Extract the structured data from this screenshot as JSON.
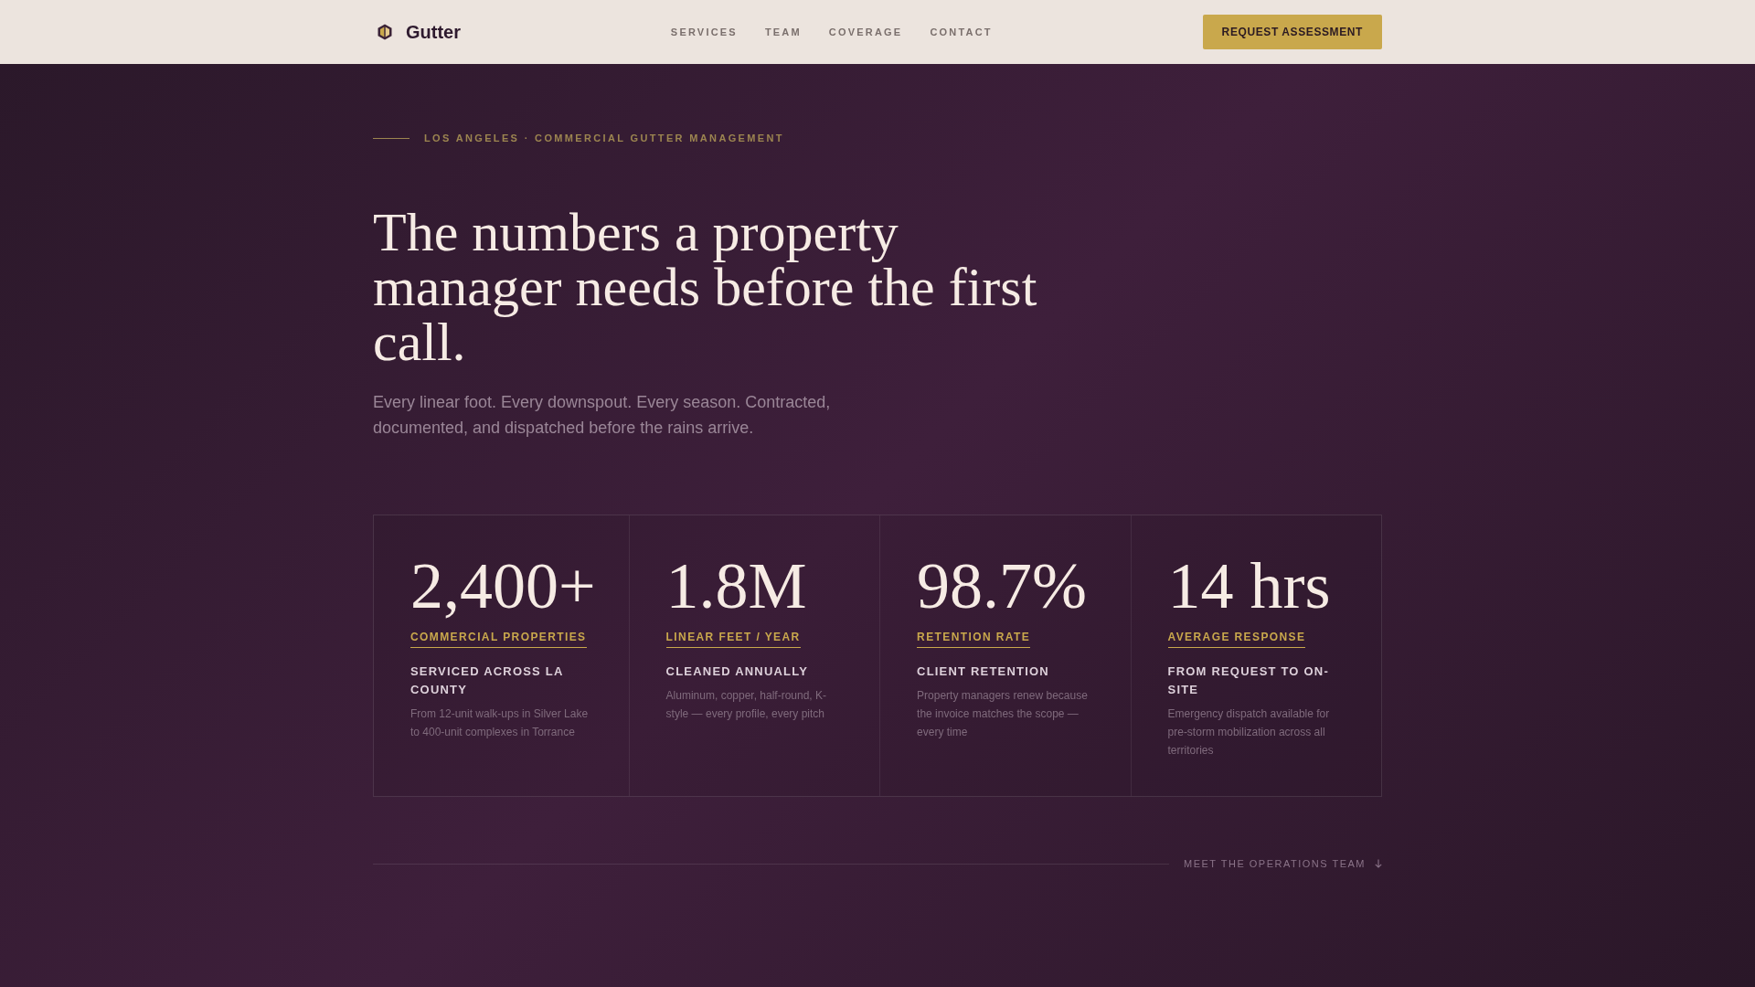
{
  "nav": {
    "brand": "Gutter",
    "links": [
      "SERVICES",
      "TEAM",
      "COVERAGE",
      "CONTACT"
    ],
    "cta": "REQUEST ASSESSMENT"
  },
  "hero": {
    "eyebrow": "LOS ANGELES · COMMERCIAL GUTTER MANAGEMENT",
    "heading": "The numbers a property manager needs before the first call.",
    "subtitle": "Every linear foot. Every downspout. Every season. Contracted, documented, and dispatched before the rains arrive."
  },
  "stats": [
    {
      "value": "2,400+",
      "label": "COMMERCIAL PROPERTIES",
      "title": "SERVICED ACROSS LA COUNTY",
      "description": "From 12-unit walk-ups in Silver Lake to 400-unit complexes in Torrance"
    },
    {
      "value": "1.8M",
      "label": "LINEAR FEET / YEAR",
      "title": "CLEANED ANNUALLY",
      "description": "Aluminum, copper, half-round, K-style — every profile, every pitch"
    },
    {
      "value": "98.7%",
      "label": "RETENTION RATE",
      "title": "CLIENT RETENTION",
      "description": "Property managers renew because the invoice matches the scope — every time"
    },
    {
      "value": "14 hrs",
      "label": "AVERAGE RESPONSE",
      "title": "FROM REQUEST TO ON-SITE",
      "description": "Emergency dispatch available for pre-storm mobilization across all territories"
    }
  ],
  "footer_link": {
    "label": "MEET THE OPERATIONS TEAM"
  }
}
